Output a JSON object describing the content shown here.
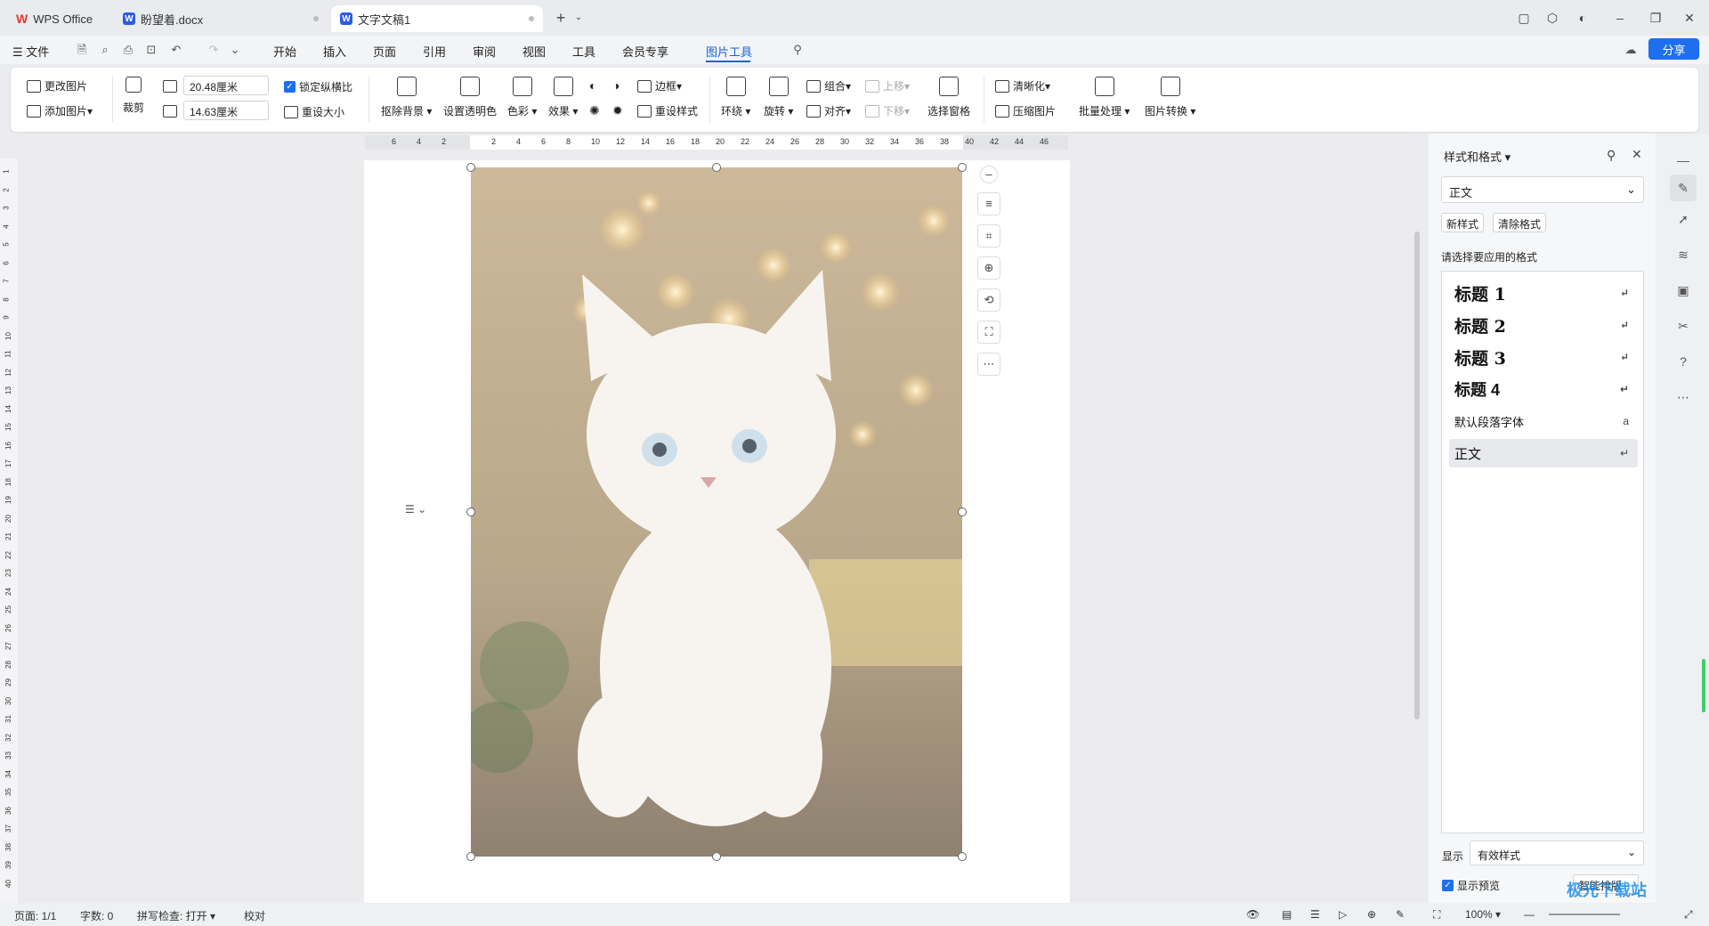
{
  "tabs": [
    {
      "label": "WPS Office"
    },
    {
      "label": "盼望着.docx"
    },
    {
      "label": "文字文稿1"
    }
  ],
  "menubar": {
    "file": "文件",
    "items": [
      "开始",
      "插入",
      "页面",
      "引用",
      "审阅",
      "视图",
      "工具",
      "会员专享",
      "图片工具"
    ],
    "share": "分享"
  },
  "ribbon": {
    "change_picture": "更改图片",
    "add_picture": "添加图片",
    "crop": "裁剪",
    "width": "20.48厘米",
    "height": "14.63厘米",
    "lock_ratio": "锁定纵横比",
    "reset_size": "重设大小",
    "remove_bg": "抠除背景",
    "set_transparent": "设置透明色",
    "color": "色彩",
    "effect": "效果",
    "border": "边框",
    "reset_style": "重设样式",
    "wrap": "环绕",
    "rotate": "旋转",
    "group": "组合",
    "align": "对齐",
    "move_up": "上移",
    "move_down": "下移",
    "selection_pane": "选择窗格",
    "sharpen": "清晰化",
    "compress": "压缩图片",
    "batch": "批量处理",
    "convert": "图片转换"
  },
  "ruler_h": [
    "6",
    "4",
    "2",
    "",
    "2",
    "4",
    "6",
    "8",
    "10",
    "12",
    "14",
    "16",
    "18",
    "20",
    "22",
    "24",
    "26",
    "28",
    "30",
    "32",
    "34",
    "36",
    "38",
    "40",
    "42",
    "44",
    "46"
  ],
  "ruler_v": [
    "1",
    "2",
    "3",
    "4",
    "5",
    "6",
    "7",
    "8",
    "9",
    "10",
    "11",
    "12",
    "13",
    "14",
    "15",
    "16",
    "17",
    "18",
    "19",
    "20",
    "21",
    "22",
    "23",
    "24",
    "25",
    "26",
    "27",
    "28",
    "29",
    "30",
    "31",
    "32",
    "33",
    "34",
    "35",
    "36",
    "37",
    "38",
    "39",
    "40"
  ],
  "panel": {
    "title": "样式和格式",
    "current_style": "正文",
    "new_style": "新样式",
    "clear_format": "清除格式",
    "prompt": "请选择要应用的格式",
    "styles": [
      {
        "label": "标题  1",
        "size": "heading"
      },
      {
        "label": "标题  2",
        "size": "heading"
      },
      {
        "label": "标题  3",
        "size": "heading"
      },
      {
        "label": "标题  4",
        "size": "heading"
      },
      {
        "label": "默认段落字体",
        "size": "small"
      },
      {
        "label": "正文",
        "size": "normal"
      }
    ],
    "show_label": "显示",
    "show_value": "有效样式",
    "show_preview": "显示预览",
    "smart": "智能排版"
  },
  "status": {
    "page": "页面: 1/1",
    "words": "字数: 0",
    "spell": "拼写检查: 打开",
    "proof": "校对",
    "zoom": "100%"
  },
  "watermark": "极光下载站"
}
